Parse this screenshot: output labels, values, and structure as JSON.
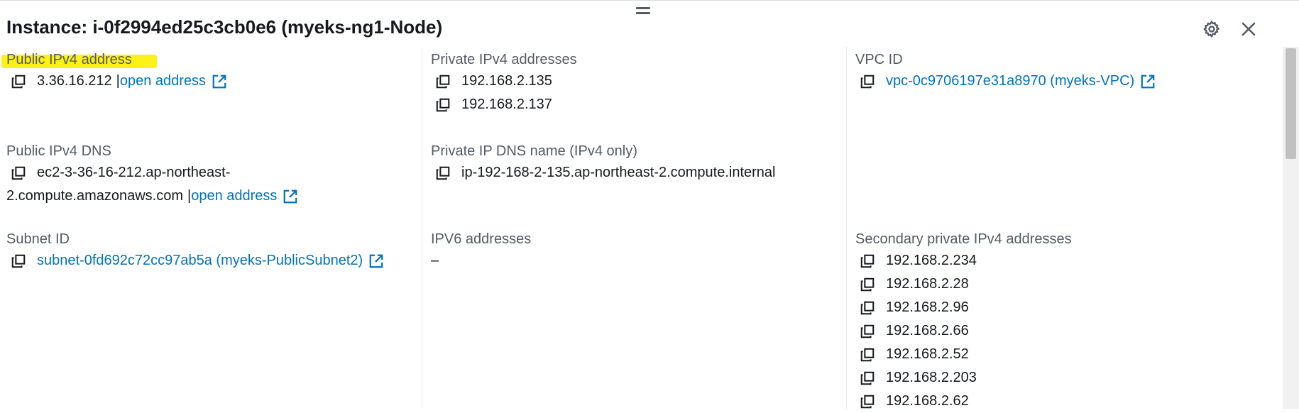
{
  "header": {
    "title": "Instance: i-0f2994ed25c3cb0e6 (myeks-ng1-Node)",
    "settings_icon": "gear-icon",
    "close_icon": "close-icon"
  },
  "colors": {
    "link": "#0073bb",
    "highlight": "#fcf11a",
    "label": "#545b64"
  },
  "col1": {
    "public_ipv4": {
      "label": "Public IPv4 address",
      "value": "3.36.16.212",
      "separator": "|",
      "link": "open address"
    },
    "public_dns": {
      "label": "Public IPv4 DNS",
      "value_line1": "ec2-3-36-16-212.ap-northeast-",
      "value_line2": "2.compute.amazonaws.com",
      "separator": "|",
      "link": "open address"
    },
    "subnet": {
      "label": "Subnet ID",
      "link": "subnet-0fd692c72cc97ab5a (myeks-PublicSubnet2)"
    }
  },
  "col2": {
    "private_ipv4": {
      "label": "Private IPv4 addresses",
      "values": [
        "192.168.2.135",
        "192.168.2.137"
      ]
    },
    "private_dns": {
      "label": "Private IP DNS name (IPv4 only)",
      "value": "ip-192-168-2-135.ap-northeast-2.compute.internal"
    },
    "ipv6": {
      "label": "IPV6 addresses",
      "value": "–"
    }
  },
  "col3": {
    "vpc": {
      "label": "VPC ID",
      "link": "vpc-0c9706197e31a8970 (myeks-VPC)"
    },
    "secondary": {
      "label": "Secondary private IPv4 addresses",
      "values": [
        "192.168.2.234",
        "192.168.2.28",
        "192.168.2.96",
        "192.168.2.66",
        "192.168.2.52",
        "192.168.2.203",
        "192.168.2.62"
      ]
    }
  }
}
